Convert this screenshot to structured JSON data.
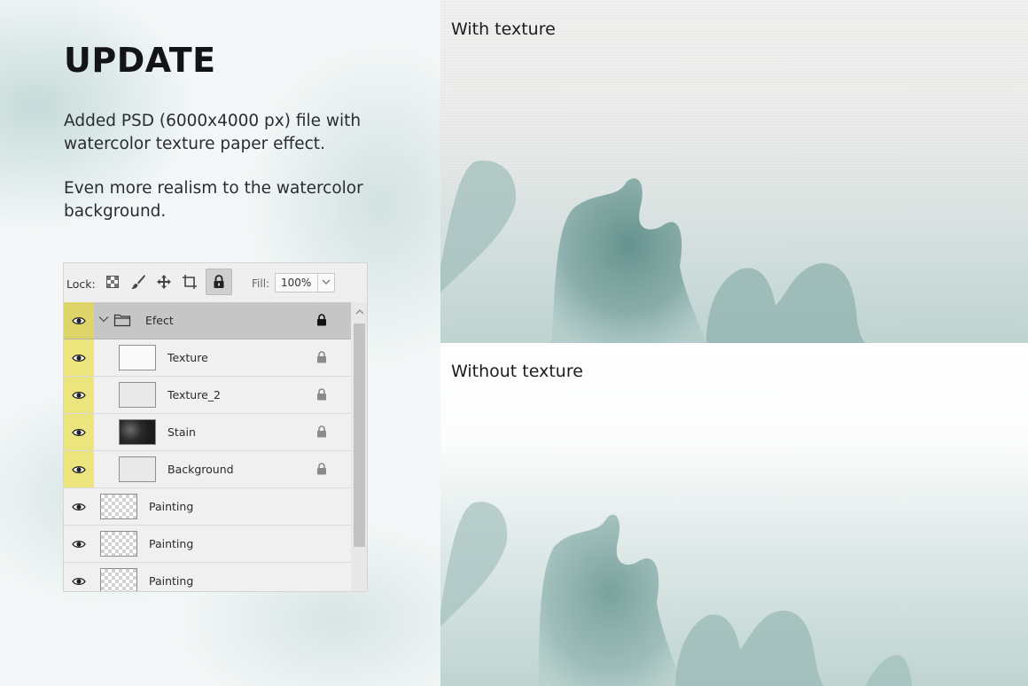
{
  "promo": {
    "title": "UPDATE",
    "paragraph1": "Added PSD (6000x4000 px) file with watercolor texture paper effect.",
    "paragraph2": "Even more realism to the watercolor background."
  },
  "layers_panel": {
    "lock_label": "Lock:",
    "fill_label": "Fill:",
    "fill_value": "100%",
    "lock_icons": [
      "lock-transparent-pixels-icon",
      "lock-image-pixels-icon",
      "lock-position-icon",
      "lock-artboard-icon",
      "lock-all-icon"
    ],
    "group": {
      "name": "Efect",
      "visible": true,
      "locked": true
    },
    "layers": [
      {
        "name": "Texture",
        "thumb": "light",
        "in_group": true,
        "locked": true
      },
      {
        "name": "Texture_2",
        "thumb": "light",
        "in_group": true,
        "locked": true
      },
      {
        "name": "Stain",
        "thumb": "dark",
        "in_group": true,
        "locked": true
      },
      {
        "name": "Background",
        "thumb": "light",
        "in_group": true,
        "locked": true
      },
      {
        "name": "Painting",
        "thumb": "transparent",
        "in_group": false,
        "locked": false
      },
      {
        "name": "Painting",
        "thumb": "transparent",
        "in_group": false,
        "locked": false
      },
      {
        "name": "Painting",
        "thumb": "transparent",
        "in_group": false,
        "locked": false
      }
    ]
  },
  "previews": {
    "with_texture_label": "With texture",
    "without_texture_label": "Without texture"
  },
  "colors": {
    "visibility_highlight": "#ece47c",
    "watercolor_teal": "#6f9a96",
    "title_text": "#121416"
  }
}
